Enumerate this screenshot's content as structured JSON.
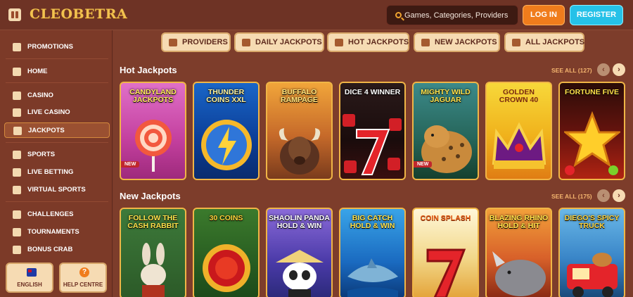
{
  "header": {
    "logo_text": "CLEOBETRA",
    "search_placeholder": "Games, Categories, Providers",
    "login_label": "LOG IN",
    "register_label": "REGISTER"
  },
  "sidebar": {
    "items": [
      {
        "label": "PROMOTIONS",
        "icon": "gift-icon"
      },
      {
        "label": "HOME",
        "icon": "home-icon"
      },
      {
        "label": "CASINO",
        "icon": "slot-icon"
      },
      {
        "label": "LIVE CASINO",
        "icon": "cards-icon"
      },
      {
        "label": "JACKPOTS",
        "icon": "jackpot-icon",
        "active": true
      },
      {
        "label": "SPORTS",
        "icon": "football-icon"
      },
      {
        "label": "LIVE BETTING",
        "icon": "live-icon"
      },
      {
        "label": "VIRTUAL SPORTS",
        "icon": "virtual-icon"
      },
      {
        "label": "CHALLENGES",
        "icon": "medal-icon"
      },
      {
        "label": "TOURNAMENTS",
        "icon": "trophy-icon"
      },
      {
        "label": "BONUS CRAB",
        "icon": "crab-icon"
      }
    ],
    "language_label": "ENGLISH",
    "help_label": "HELP CENTRE"
  },
  "tabs": [
    {
      "label": "PROVIDERS",
      "icon": "providers-icon"
    },
    {
      "label": "DAILY JACKPOTS",
      "icon": "calendar-icon"
    },
    {
      "label": "HOT JACKPOTS",
      "icon": "flame-icon"
    },
    {
      "label": "NEW JACKPOTS",
      "icon": "bell-icon"
    },
    {
      "label": "ALL JACKPOTS",
      "icon": "coins-icon"
    }
  ],
  "sections": {
    "hot": {
      "title": "Hot Jackpots",
      "see_all": "SEE ALL (127)",
      "games": [
        {
          "title": "CANDYLAND JACKPOTS",
          "badge": "NEW"
        },
        {
          "title": "THUNDER COINS XXL",
          "badge": ""
        },
        {
          "title": "BUFFALO RAMPAGE",
          "badge": ""
        },
        {
          "title": "DICE 4 WINNER",
          "badge": ""
        },
        {
          "title": "MIGHTY WILD JAGUAR",
          "badge": "NEW"
        },
        {
          "title": "GOLDEN CROWN 40",
          "badge": ""
        },
        {
          "title": "FORTUNE FIVE",
          "badge": ""
        }
      ]
    },
    "new": {
      "title": "New Jackpots",
      "see_all": "SEE ALL (175)",
      "games": [
        {
          "title": "FOLLOW THE CASH RABBIT"
        },
        {
          "title": "30 COINS"
        },
        {
          "title": "SHAOLIN PANDA HOLD & WIN"
        },
        {
          "title": "BIG CATCH HOLD & WIN"
        },
        {
          "title": "COIN SPLASH"
        },
        {
          "title": "BLAZING RHINO HOLD & HIT"
        },
        {
          "title": "DIEGO'S SPICY TRUCK"
        }
      ]
    }
  },
  "colors": {
    "background": "#7a3b2a",
    "accent_orange": "#f07c1c",
    "accent_cyan": "#25c1e8",
    "card_border": "#f0b546"
  }
}
